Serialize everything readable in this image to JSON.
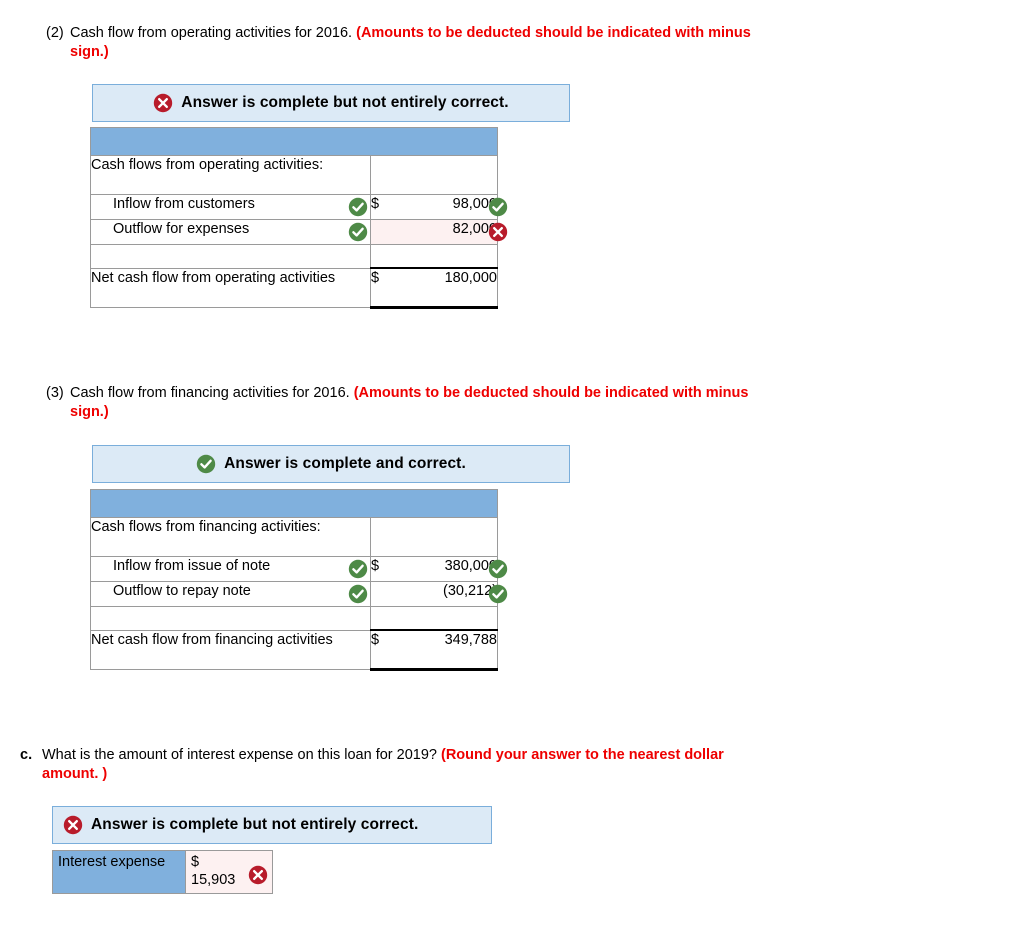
{
  "colors": {
    "header_blue": "#80b0dd",
    "banner_bg": "#dceaf6",
    "banner_border": "#7aaedb",
    "red_text": "#ee0000",
    "correct_green": "#4e8a47",
    "incorrect_red": "#b81c2b",
    "row_ok_bg": "#f6faf5",
    "row_bad_bg": "#fdf1f1"
  },
  "sections": [
    {
      "number": "(2)",
      "prompt_plain": "Cash flow from operating activities for 2016. ",
      "prompt_red": "(Amounts to be deducted should be indicated with minus sign.)",
      "banner": {
        "icon": "x-circle-icon",
        "status": "incorrect",
        "text": "Answer is complete but not entirely correct."
      },
      "table": {
        "header_label": "",
        "rows": [
          {
            "label": "Cash flows from operating activities:",
            "indent": false,
            "dollar": "",
            "value": "",
            "label_mark": "",
            "value_mark": "",
            "state": "plain",
            "type": "header-row"
          },
          {
            "label": "Inflow from customers",
            "indent": true,
            "dollar": "$",
            "value": "98,000",
            "label_mark": "check-circle-icon",
            "value_mark": "check-circle-icon",
            "state": "ok",
            "type": "data"
          },
          {
            "label": "Outflow for expenses",
            "indent": true,
            "dollar": "",
            "value": "82,000",
            "label_mark": "check-circle-icon",
            "value_mark": "x-circle-icon",
            "state": "bad",
            "type": "data"
          },
          {
            "label": "",
            "indent": false,
            "dollar": "",
            "value": "",
            "label_mark": "",
            "value_mark": "",
            "state": "plain",
            "type": "spacer"
          },
          {
            "label": "Net cash flow from operating activities",
            "indent": false,
            "dollar": "$",
            "value": "180,000",
            "label_mark": "",
            "value_mark": "",
            "state": "plain",
            "type": "total"
          }
        ]
      }
    },
    {
      "number": "(3)",
      "prompt_plain": "Cash flow from financing activities for 2016. ",
      "prompt_red": "(Amounts to be deducted should be indicated with minus sign.)",
      "banner": {
        "icon": "check-circle-icon",
        "status": "correct",
        "text": "Answer is complete and correct."
      },
      "table": {
        "header_label": "",
        "rows": [
          {
            "label": "Cash flows from financing activities:",
            "indent": false,
            "dollar": "",
            "value": "",
            "label_mark": "",
            "value_mark": "",
            "state": "plain",
            "type": "header-row"
          },
          {
            "label": "Inflow from issue of note",
            "indent": true,
            "dollar": "$",
            "value": "380,000",
            "label_mark": "check-circle-icon",
            "value_mark": "check-circle-icon",
            "state": "ok",
            "type": "data"
          },
          {
            "label": "Outflow to repay note",
            "indent": true,
            "dollar": "",
            "value": "(30,212)",
            "label_mark": "check-circle-icon",
            "value_mark": "check-circle-icon",
            "state": "ok",
            "type": "data"
          },
          {
            "label": "",
            "indent": false,
            "dollar": "",
            "value": "",
            "label_mark": "",
            "value_mark": "",
            "state": "plain",
            "type": "spacer"
          },
          {
            "label": "Net cash flow from financing activities",
            "indent": false,
            "dollar": "$",
            "value": "349,788",
            "label_mark": "",
            "value_mark": "",
            "state": "plain",
            "type": "total"
          }
        ]
      }
    }
  ],
  "part_c": {
    "letter": "c.",
    "prompt_plain": "What is the amount of interest expense on this loan for 2019? ",
    "prompt_red": "(Round your answer to the nearest dollar amount. )",
    "banner": {
      "icon": "x-circle-icon",
      "status": "incorrect",
      "text": "Answer is complete but not entirely correct."
    },
    "table": {
      "label": "Interest expense",
      "dollar": "$",
      "value": "15,903",
      "value_mark": "x-circle-icon"
    }
  }
}
